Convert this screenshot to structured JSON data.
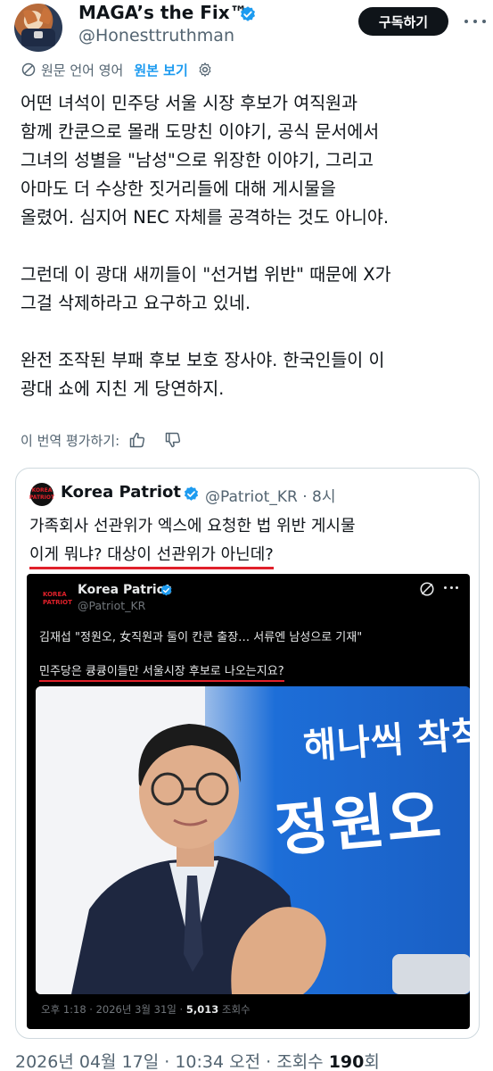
{
  "colors": {
    "accent": "#1d9bf0",
    "text": "#0f1419",
    "muted": "#536471",
    "underline_red": "#e0202a",
    "button_bg": "#0f1419"
  },
  "author": {
    "name": "MAGA’s the Fix™",
    "handle": "@Honesttruthman",
    "subscribe_label": "구독하기",
    "icons": [
      "verified-badge-icon",
      "more-icon"
    ]
  },
  "translation": {
    "label": "원문 언어 영어",
    "show_original": "원본 보기",
    "icons": [
      "translate-icon",
      "gear-icon"
    ]
  },
  "post": {
    "paragraphs": [
      "어떤 녀석이 민주당 서울 시장 후보가 여직원과\n함께 칸쿤으로 몰래 도망친 이야기, 공식 문서에서\n그녀의 성별을 \"남성\"으로 위장한 이야기, 그리고\n아마도 더 수상한 짓거리들에 대해 게시물을\n올렸어. 심지어 NEC 자체를 공격하는 것도 아니야.",
      "그런데 이 광대 새끼들이 \"선거법 위반\" 때문에 X가\n그걸 삭제하라고 요구하고 있네.",
      "완전 조작된 부패 후보 보호 장사야. 한국인들이 이\n광대 쇼에 지친 게 당연하지."
    ]
  },
  "rate": {
    "label": "이 번역 평가하기:",
    "icons": [
      "thumbs-up-icon",
      "thumbs-down-icon"
    ]
  },
  "quote": {
    "logo_text": [
      "KOREA",
      "PATRIOT"
    ],
    "name": "Korea Patriot",
    "handle_time": "@Patriot_KR · 8시",
    "line1": "가족회사 선관위가 엑스에 요청한 법 위반 게시물",
    "line2": "이게 뭐냐? 대상이 선관위가 아닌데?",
    "embedded": {
      "logo_text": [
        "KOREA",
        "PATRIOT"
      ],
      "name": "Korea Patriot",
      "handle": "@Patriot_KR",
      "line1": "김재섭 \"정원오, 女직원과 둘이 칸쿤 출장… 서류엔 남성으로 기재\"",
      "line2": "민주당은 큥큥이들만 서울시장 후보로 나오는지요?",
      "banner_top": "해나씩 착착",
      "banner_main": "정원오",
      "meta_prefix": "오후 1:18 · 2026년 3월 31일 · ",
      "meta_views": "5,013",
      "meta_suffix": " 조회수"
    }
  },
  "footer": {
    "prefix": "2026년 04월 17일 · 10:34 오전 · 조회수 ",
    "views": "190",
    "suffix": "회"
  }
}
